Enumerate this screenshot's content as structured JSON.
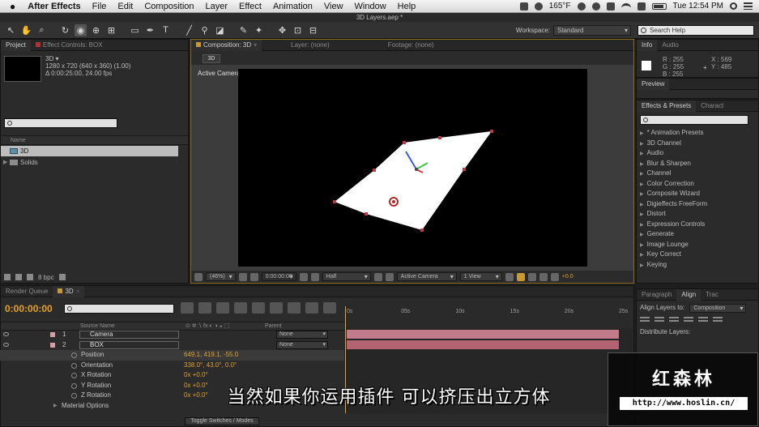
{
  "menubar": {
    "app": "After Effects",
    "items": [
      "File",
      "Edit",
      "Composition",
      "Layer",
      "Effect",
      "Animation",
      "View",
      "Window",
      "Help"
    ],
    "temperature": "165°F",
    "clock": "Tue 12:54 PM"
  },
  "window": {
    "title": "3D Layers.aep *"
  },
  "toolbar": {
    "workspace_label": "Workspace:",
    "workspace_value": "Standard",
    "search_placeholder": "Search Help"
  },
  "project": {
    "tabs": {
      "project": "Project",
      "effect_controls": "Effect Controls: BOX"
    },
    "item": {
      "name": "3D ▾",
      "res": "1280 x 720  (640 x 360) (1.00)",
      "duration": "Δ 0:00:25:00, 24.00 fps"
    },
    "col_name": "Name",
    "rows": [
      "3D",
      "Solids"
    ],
    "bpc": "8 bpc"
  },
  "comp": {
    "tabs": {
      "composition": "Composition: 3D",
      "layer": "Layer: (none)",
      "footage": "Footage: (none)"
    },
    "subtab": "3D",
    "active_camera_label": "Active Camera",
    "footer": {
      "zoom": "(46%)",
      "timecode": "0:00:00:00",
      "resolution": "Half",
      "view": "Active Camera",
      "views": "1 View",
      "exposure": "+0.0"
    }
  },
  "info": {
    "tabs": {
      "info": "Info",
      "audio": "Audio"
    },
    "r": "R : 255",
    "g": "G : 255",
    "b": "B : 255",
    "x": "X : 569",
    "y": "Y : 485"
  },
  "preview": {
    "tab": "Preview"
  },
  "effects": {
    "tabs": {
      "effects": "Effects & Presets",
      "character": "Charact"
    },
    "items": [
      "* Animation Presets",
      "3D Channel",
      "Audio",
      "Blur & Sharpen",
      "Channel",
      "Color Correction",
      "Composite Wizard",
      "Digieffects FreeForm",
      "Distort",
      "Expression Controls",
      "Generate",
      "Image Lounge",
      "Key Correct",
      "Keying"
    ]
  },
  "align": {
    "tabs": {
      "paragraph": "Paragraph",
      "align": "Align",
      "tracker": "Trac"
    },
    "align_to_label": "Align Layers to:",
    "align_to_value": "Composition",
    "distribute_label": "Distribute Layers:"
  },
  "timeline": {
    "tabs": {
      "render_queue": "Render Queue",
      "comp": "3D"
    },
    "time": "0:00:00:00",
    "col_source": "Source Name",
    "col_parent": "Parent",
    "layers": [
      {
        "num": "1",
        "name": "Camera",
        "parent": "None"
      },
      {
        "num": "2",
        "name": "BOX",
        "parent": "None"
      }
    ],
    "props": [
      {
        "name": "Position",
        "value": "649.1, 419.1, -55.0"
      },
      {
        "name": "Orientation",
        "value": "338.0°, 43.0°, 0.0°"
      },
      {
        "name": "X Rotation",
        "value": "0x +0.0°"
      },
      {
        "name": "Y Rotation",
        "value": "0x +0.0°"
      },
      {
        "name": "Z Rotation",
        "value": "0x +0.0°"
      },
      {
        "name": "Material Options",
        "value": ""
      }
    ],
    "ruler": [
      "0s",
      "05s",
      "10s",
      "15s",
      "20s",
      "25s"
    ],
    "toggle_label": "Toggle Switches / Modes"
  },
  "overlay": {
    "subtitle": "当然如果你运用插件 可以挤压出立方体",
    "logo": "红森林",
    "url": "http://www.hoslin.cn/"
  }
}
